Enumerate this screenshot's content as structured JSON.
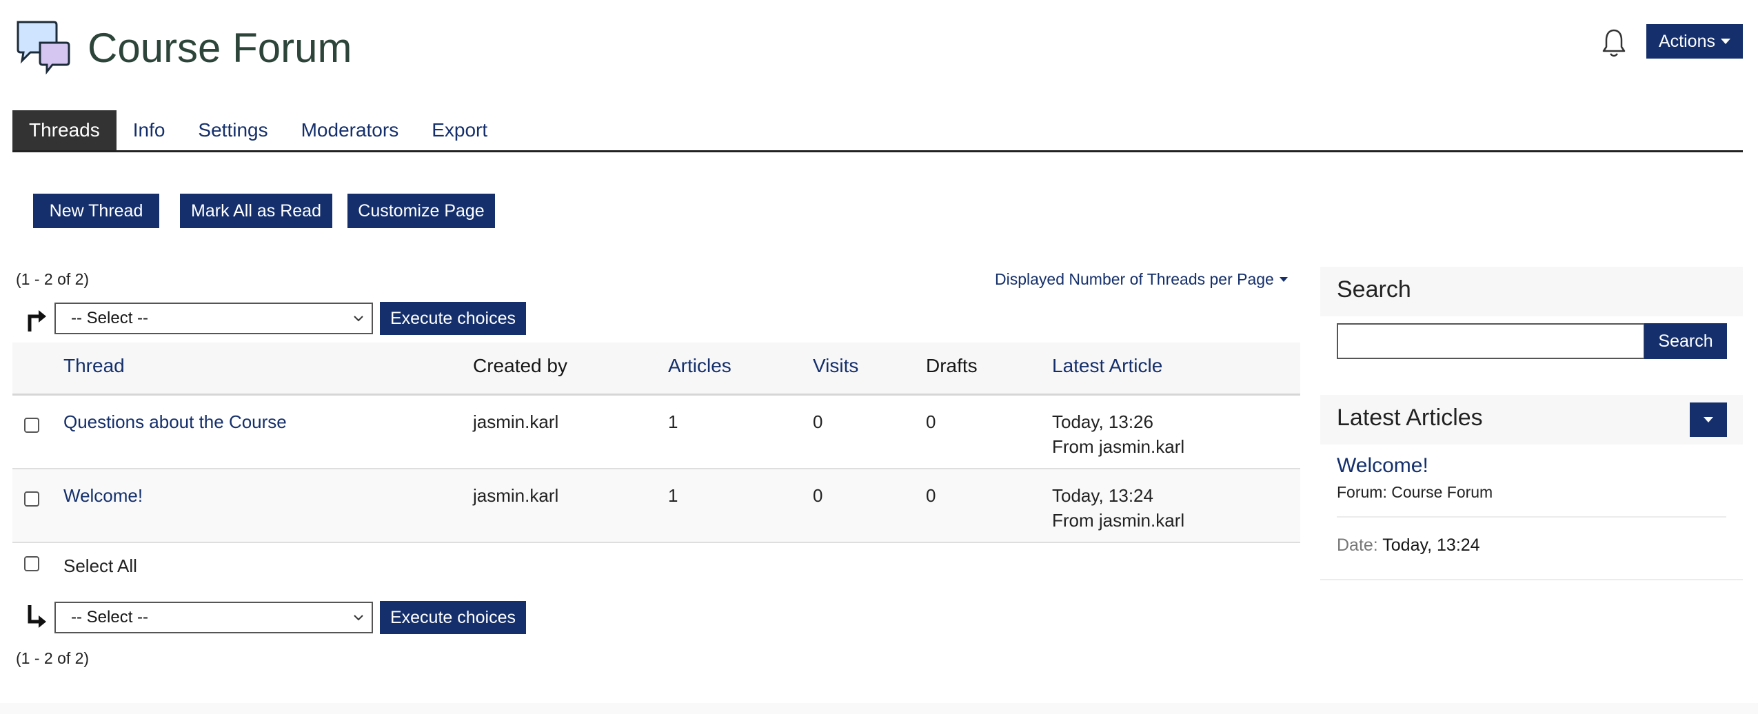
{
  "header": {
    "title": "Course Forum",
    "icon": "speech-bubbles-icon",
    "notifications_icon": "bell-icon",
    "actions_label": "Actions"
  },
  "tabs": [
    {
      "label": "Threads",
      "active": true
    },
    {
      "label": "Info",
      "active": false
    },
    {
      "label": "Settings",
      "active": false
    },
    {
      "label": "Moderators",
      "active": false
    },
    {
      "label": "Export",
      "active": false
    }
  ],
  "toolbar": {
    "new_thread": "New Thread",
    "mark_all_read": "Mark All as Read",
    "customize_page": "Customize Page"
  },
  "list": {
    "count_top": "(1 - 2 of 2)",
    "count_bottom": "(1 - 2 of 2)",
    "per_page_label": "Displayed Number of Threads per Page",
    "select_top": "-- Select --",
    "select_bottom": "-- Select --",
    "execute_top": "Execute choices",
    "execute_bottom": "Execute choices",
    "select_all": "Select All"
  },
  "table": {
    "columns": [
      "Thread",
      "Created by",
      "Articles",
      "Visits",
      "Drafts",
      "Latest Article"
    ],
    "rows": [
      {
        "thread": "Questions about the Course",
        "created_by": "jasmin.karl",
        "articles": "1",
        "visits": "0",
        "drafts": "0",
        "latest_time": "Today, 13:26",
        "latest_from": "From jasmin.karl"
      },
      {
        "thread": "Welcome!",
        "created_by": "jasmin.karl",
        "articles": "1",
        "visits": "0",
        "drafts": "0",
        "latest_time": "Today, 13:24",
        "latest_from": "From jasmin.karl"
      }
    ]
  },
  "search_panel": {
    "title": "Search",
    "input_value": "",
    "button_label": "Search"
  },
  "latest_articles": {
    "title": "Latest Articles",
    "items": [
      {
        "title": "Welcome!",
        "forum": "Forum: Course Forum",
        "date_label": "Date:",
        "date_value": "Today, 13:24"
      }
    ]
  },
  "colors": {
    "primary": "#142f6b",
    "title": "#2c4439",
    "active_tab": "#333333"
  }
}
